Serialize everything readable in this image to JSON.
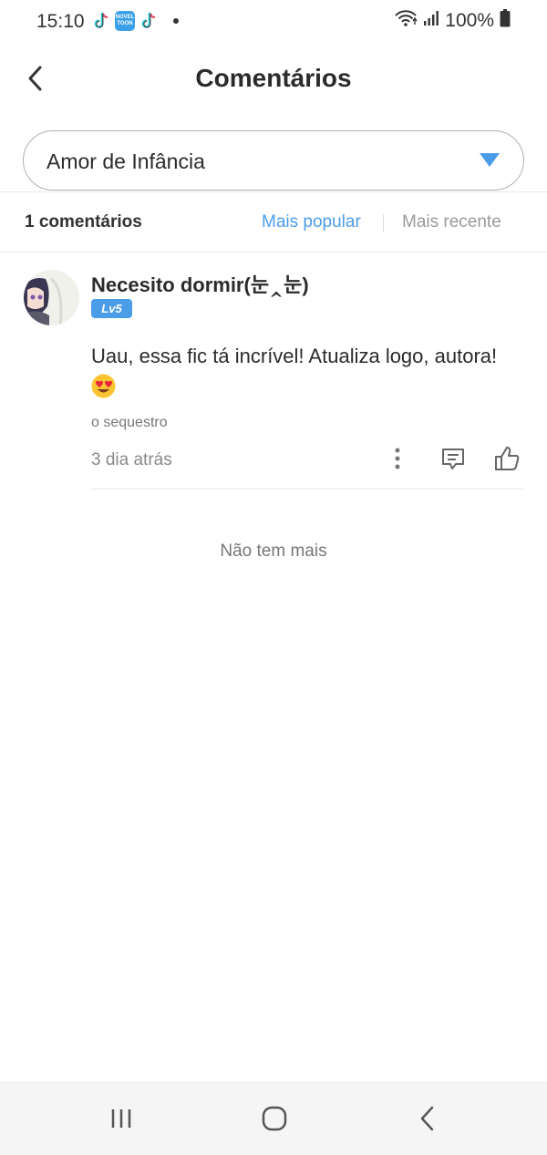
{
  "status_bar": {
    "time": "15:10",
    "battery": "100%",
    "app_icons": [
      "tiktok-icon",
      "webtoon-icon",
      "tiktok-icon"
    ],
    "webtoon_icon_text": "NOVEL TOON"
  },
  "header": {
    "title": "Comentários"
  },
  "story_select": {
    "selected": "Amor de Infância"
  },
  "sort_bar": {
    "count_label": "1 comentários",
    "popular_label": "Mais popular",
    "recent_label": "Mais recente",
    "active": "popular"
  },
  "comments": [
    {
      "username": "Necesito dormir(눈‸눈)",
      "level": "Lv5",
      "text": "Uau, essa fic tá incrível! Atualiza logo, autora!",
      "emoji": "heart-eyes-emoji",
      "chapter": "o sequestro",
      "time_ago": "3 dia atrás"
    }
  ],
  "footer_text": "Não tem mais",
  "colors": {
    "accent": "#4b9de8",
    "text": "#2b2b2b",
    "muted": "#8a8a8a"
  }
}
